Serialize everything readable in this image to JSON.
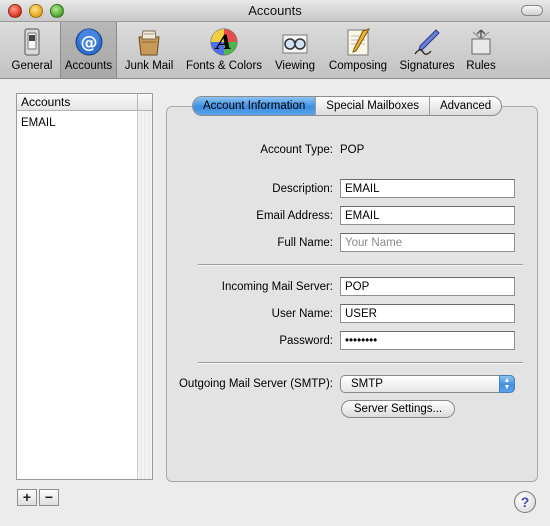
{
  "window": {
    "title": "Accounts"
  },
  "toolbar": {
    "items": [
      {
        "label": "General",
        "icon": "switch-icon"
      },
      {
        "label": "Accounts",
        "icon": "at-sign-icon",
        "selected": true
      },
      {
        "label": "Junk Mail",
        "icon": "junk-mail-icon"
      },
      {
        "label": "Fonts & Colors",
        "icon": "fonts-colors-icon"
      },
      {
        "label": "Viewing",
        "icon": "viewing-glasses-icon"
      },
      {
        "label": "Composing",
        "icon": "composing-pencil-icon"
      },
      {
        "label": "Signatures",
        "icon": "signature-pen-icon"
      },
      {
        "label": "Rules",
        "icon": "rules-icon"
      }
    ]
  },
  "accounts_list": {
    "header": "Accounts",
    "items": [
      "EMAIL"
    ],
    "add_label": "+",
    "remove_label": "−"
  },
  "tabs": [
    {
      "label": "Account Information",
      "active": true
    },
    {
      "label": "Special Mailboxes",
      "active": false
    },
    {
      "label": "Advanced",
      "active": false
    }
  ],
  "form": {
    "account_type_label": "Account Type:",
    "account_type_value": "POP",
    "description_label": "Description:",
    "description_value": "EMAIL",
    "email_label": "Email Address:",
    "email_value": "EMAIL",
    "fullname_label": "Full Name:",
    "fullname_value": "",
    "fullname_placeholder": "Your Name",
    "incoming_label": "Incoming Mail Server:",
    "incoming_value": "POP",
    "username_label": "User Name:",
    "username_value": "USER",
    "password_label": "Password:",
    "password_value": "••••••••",
    "outgoing_label": "Outgoing Mail Server (SMTP):",
    "outgoing_value": "SMTP",
    "server_settings_label": "Server Settings..."
  },
  "help": {
    "label": "?"
  },
  "colors": {
    "accent": "#3d8ee0",
    "window_bg": "#ececec"
  }
}
